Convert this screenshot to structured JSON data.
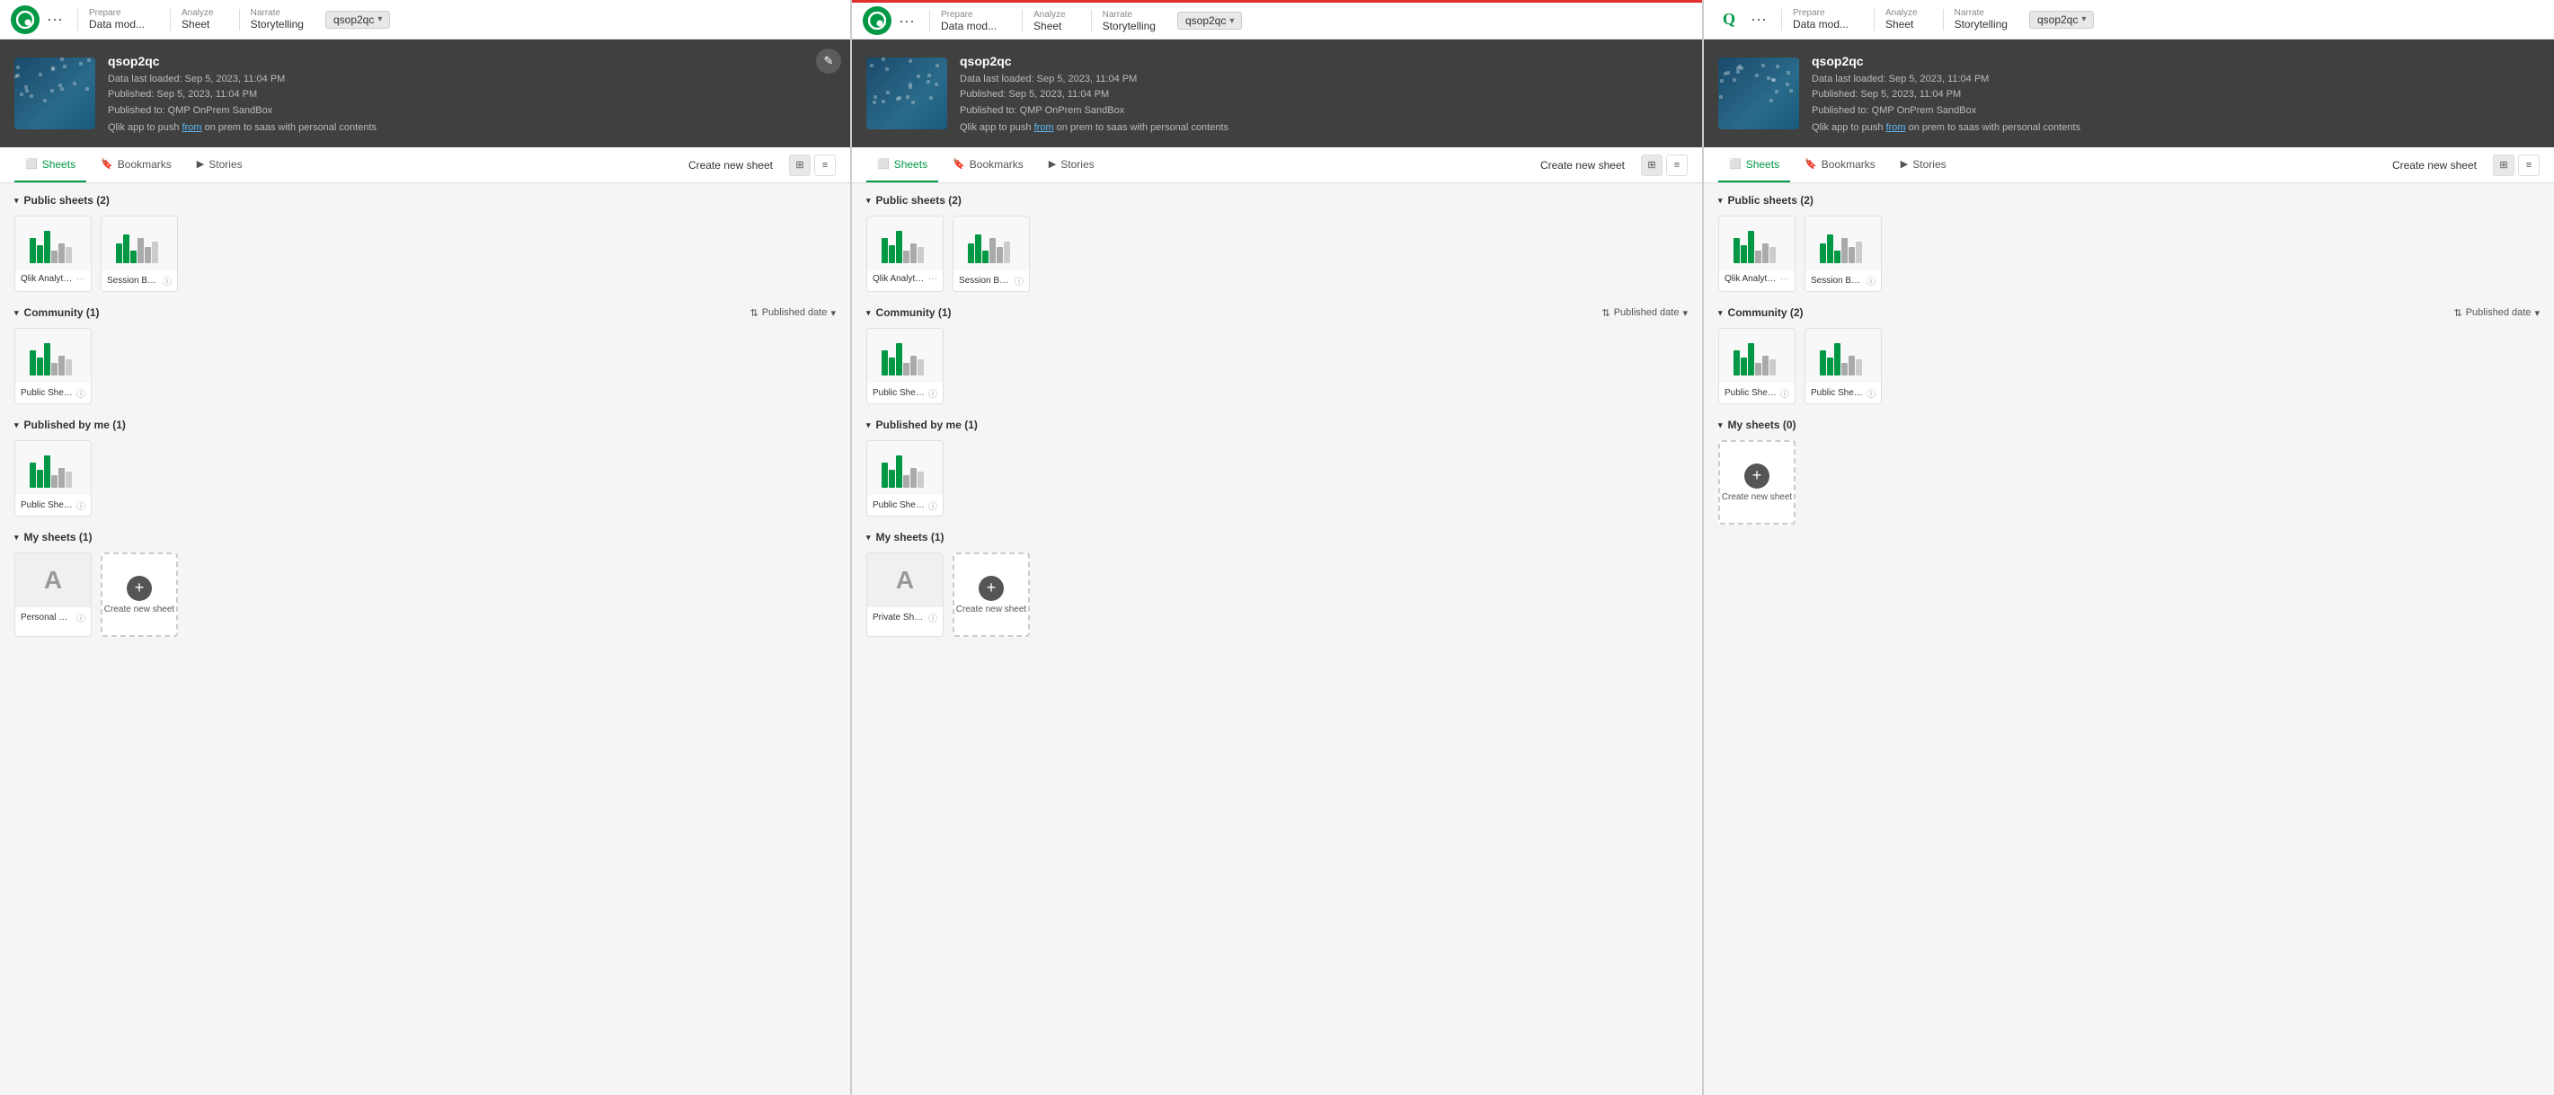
{
  "panels": [
    {
      "id": "panel-1",
      "topbar": {
        "prepare_label": "Prepare",
        "prepare_sub": "Data mod...",
        "analyze_label": "Analyze",
        "analyze_sub": "Sheet",
        "narrate_label": "Narrate",
        "narrate_sub": "Storytelling",
        "badge": "qsop2qc",
        "has_edit": true
      },
      "app": {
        "name": "qsop2qc",
        "meta1": "Data last loaded: Sep 5, 2023, 11:04 PM",
        "meta2": "Published: Sep 5, 2023, 11:04 PM",
        "meta3": "Published to: QMP OnPrem SandBox",
        "desc": "Qlik app to push from on prem to saas with personal contents"
      },
      "tabs": [
        "Sheets",
        "Bookmarks",
        "Stories"
      ],
      "active_tab": "Sheets",
      "create_new_sheet_label": "Create new sheet",
      "sections": [
        {
          "title": "Public sheets (2)",
          "collapsible": true,
          "show_sort": false,
          "sheets": [
            {
              "name": "Qlik Analytic Adventure",
              "has_more": true,
              "type": "chart"
            },
            {
              "name": "Session Breakdown",
              "has_info": true,
              "type": "chart2"
            }
          ]
        },
        {
          "title": "Community (1)",
          "collapsible": true,
          "show_sort": true,
          "sort_label": "Published date",
          "sheets": [
            {
              "name": "Public Sheet (bob)",
              "has_info": true,
              "type": "chart"
            }
          ]
        },
        {
          "title": "Published by me (1)",
          "collapsible": true,
          "show_sort": false,
          "sheets": [
            {
              "name": "Public Sheet (rvr)",
              "has_info": true,
              "type": "chart"
            }
          ]
        },
        {
          "title": "My sheets (1)",
          "collapsible": true,
          "show_sort": false,
          "sheets": [
            {
              "name": "Personal Sheet (rvr)",
              "has_info": true,
              "type": "private"
            },
            {
              "name": "Create new sheet",
              "type": "create"
            }
          ]
        }
      ]
    },
    {
      "id": "panel-2",
      "topbar": {
        "prepare_label": "Prepare",
        "prepare_sub": "",
        "analyze_label": "Analyze",
        "analyze_sub": "Sheet",
        "narrate_label": "Narrate",
        "narrate_sub": "Storytelling",
        "badge": "qsop2qc",
        "has_edit": false
      },
      "app": {
        "name": "qsop2qc",
        "meta1": "Data last loaded: Sep 5, 2023, 11:04 PM",
        "meta2": "Published: Sep 5, 2023, 11:04 PM",
        "meta3": "Published to: QMP OnPrem SandBox",
        "desc": "Qlik app to push from on prem to saas with personal contents"
      },
      "tabs": [
        "Sheets",
        "Bookmarks",
        "Stories"
      ],
      "active_tab": "Sheets",
      "create_new_sheet_label": "Create new sheet",
      "sections": [
        {
          "title": "Public sheets (2)",
          "collapsible": true,
          "show_sort": false,
          "sheets": [
            {
              "name": "Qlik Analytic Adventure",
              "has_more": true,
              "type": "chart"
            },
            {
              "name": "Session Breakdown",
              "has_info": true,
              "type": "chart2"
            }
          ]
        },
        {
          "title": "Community (1)",
          "collapsible": true,
          "show_sort": true,
          "sort_label": "Published date",
          "sheets": [
            {
              "name": "Public Sheet (rvr)",
              "has_info": true,
              "type": "chart"
            }
          ]
        },
        {
          "title": "Published by me (1)",
          "collapsible": true,
          "show_sort": false,
          "sheets": [
            {
              "name": "Public Sheet (bob)",
              "has_info": true,
              "type": "chart"
            }
          ]
        },
        {
          "title": "My sheets (1)",
          "collapsible": true,
          "show_sort": false,
          "sheets": [
            {
              "name": "Private Sheet (bob)",
              "has_info": true,
              "type": "private"
            },
            {
              "name": "Create new sheet",
              "type": "create"
            }
          ]
        }
      ]
    },
    {
      "id": "panel-3",
      "topbar": {
        "prepare_label": "Prepare",
        "prepare_sub": "",
        "analyze_label": "Analyze",
        "analyze_sub": "Sheet",
        "narrate_label": "Narrate",
        "narrate_sub": "Storytelling",
        "badge": "qsop2qc",
        "has_edit": false
      },
      "app": {
        "name": "qsop2qc",
        "meta1": "Data last loaded: Sep 5, 2023, 11:04 PM",
        "meta2": "Published: Sep 5, 2023, 11:04 PM",
        "meta3": "Published to: QMP OnPrem SandBox",
        "desc": "Qlik app to push from on prem to saas with personal contents"
      },
      "tabs": [
        "Sheets",
        "Bookmarks",
        "Stories"
      ],
      "active_tab": "Sheets",
      "create_new_sheet_label": "Create new sheet",
      "sections": [
        {
          "title": "Public sheets (2)",
          "collapsible": true,
          "show_sort": false,
          "sheets": [
            {
              "name": "Qlik Analytic Adventure",
              "has_more": true,
              "type": "chart"
            },
            {
              "name": "Session Breakdown",
              "has_info": true,
              "type": "chart2"
            }
          ]
        },
        {
          "title": "Community (2)",
          "collapsible": true,
          "show_sort": true,
          "sort_label": "Published date",
          "sheets": [
            {
              "name": "Public Sheet (bob)",
              "has_info": true,
              "type": "chart"
            },
            {
              "name": "Public Sheet (rvr)",
              "has_info": true,
              "type": "chart"
            }
          ]
        },
        {
          "title": "My sheets (0)",
          "collapsible": true,
          "show_sort": false,
          "sheets": [
            {
              "name": "Create new sheet",
              "type": "create"
            }
          ]
        }
      ]
    }
  ]
}
